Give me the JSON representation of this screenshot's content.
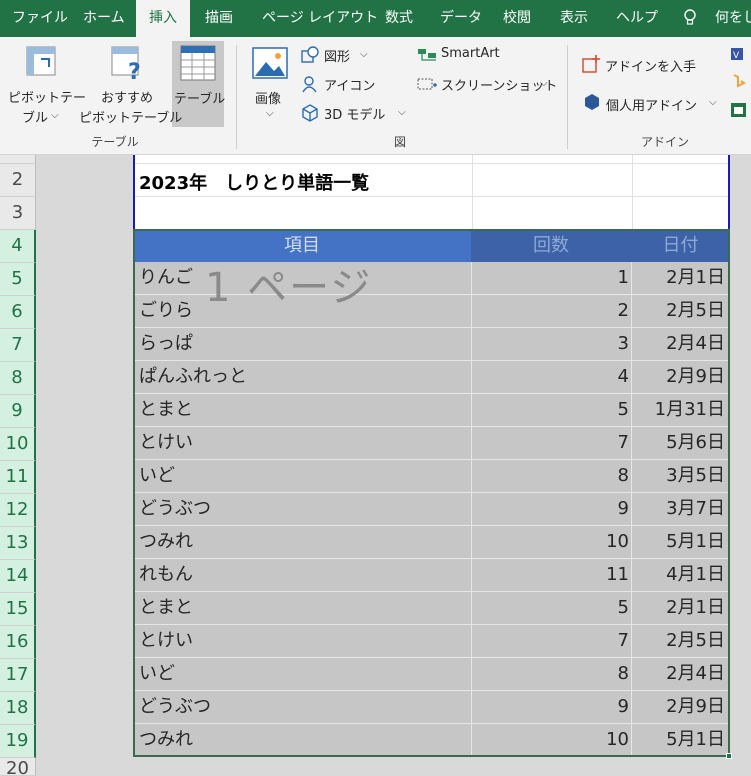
{
  "ribbon_tabs": [
    "ファイル",
    "ホーム",
    "挿入",
    "描画",
    "ページ レイアウト",
    "数式",
    "データ",
    "校閲",
    "表示",
    "ヘルプ",
    "何をし"
  ],
  "ribbon": {
    "pivot_table": "ピボットテー\nブル",
    "pivot_table_line1": "ピボットテー",
    "pivot_table_line2": "ブル",
    "recommended_pivot_line1": "おすすめ",
    "recommended_pivot_line2": "ピボットテーブル",
    "table": "テーブル",
    "group_table": "テーブル",
    "image": "画像",
    "shapes": "図形",
    "icons": "アイコン",
    "models_3d": "3D モデル",
    "smartart": "SmartArt",
    "screenshot": "スクリーンショット",
    "group_illustrations": "図",
    "get_addins": "アドインを入手",
    "personal_addins": "個人用アドイン",
    "group_addins": "アドイン"
  },
  "colors": {
    "excel_green": "#217346",
    "table_header": "#4472c4",
    "table_header_dark": "#3e62a8",
    "page_break_blue": "#1b1bb0"
  },
  "sheet": {
    "row_numbers": [
      "2",
      "3",
      "4",
      "5",
      "6",
      "7",
      "8",
      "9",
      "10",
      "11",
      "12",
      "13",
      "14",
      "15",
      "16",
      "17",
      "18",
      "19",
      "20"
    ],
    "title": "2023年　しりとり単語一覧",
    "headers": {
      "item": "項目",
      "count": "回数",
      "date": "日付"
    },
    "rows": [
      {
        "item": "りんご",
        "count": "1",
        "date": "2月1日"
      },
      {
        "item": "ごりら",
        "count": "2",
        "date": "2月5日"
      },
      {
        "item": "らっぱ",
        "count": "3",
        "date": "2月4日"
      },
      {
        "item": "ぱんふれっと",
        "count": "4",
        "date": "2月9日"
      },
      {
        "item": "とまと",
        "count": "5",
        "date": "1月31日"
      },
      {
        "item": "とけい",
        "count": "7",
        "date": "5月6日"
      },
      {
        "item": "いど",
        "count": "8",
        "date": "3月5日"
      },
      {
        "item": "どうぶつ",
        "count": "9",
        "date": "3月7日"
      },
      {
        "item": "つみれ",
        "count": "10",
        "date": "5月1日"
      },
      {
        "item": "れもん",
        "count": "11",
        "date": "4月1日"
      },
      {
        "item": "とまと",
        "count": "5",
        "date": "2月1日"
      },
      {
        "item": "とけい",
        "count": "7",
        "date": "2月5日"
      },
      {
        "item": "いど",
        "count": "8",
        "date": "2月4日"
      },
      {
        "item": "どうぶつ",
        "count": "9",
        "date": "2月9日"
      },
      {
        "item": "つみれ",
        "count": "10",
        "date": "5月1日"
      }
    ],
    "page_watermark": "1 ページ"
  }
}
